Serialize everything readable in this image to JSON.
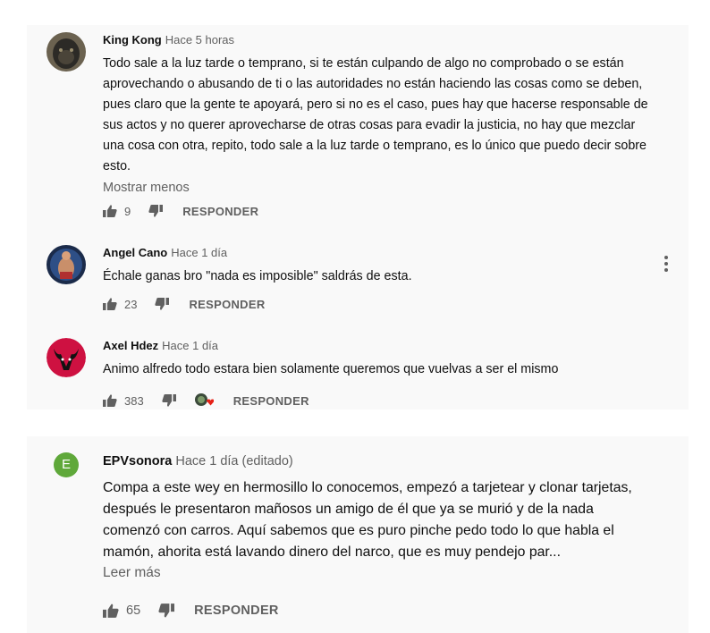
{
  "comments": [
    {
      "author": "King Kong",
      "time": "Hace 5 horas",
      "text": "Todo sale a la luz tarde o temprano, si te están culpando de algo no comprobado o se están aprovechando o abusando de ti o las autoridades no están haciendo las cosas como se deben, pues claro que la gente te apoyará, pero si no es el caso, pues hay que hacerse responsable de sus actos y no querer aprovecharse de otras cosas para evadir la justicia, no hay que mezclar una cosa con otra, repito, todo sale a la luz tarde o temprano, es lo único que puedo decir sobre esto.",
      "expand_label": "Mostrar menos",
      "likes": "9",
      "reply_label": "RESPONDER"
    },
    {
      "author": "Angel Cano",
      "time": "Hace 1 día",
      "text": "Échale ganas bro \"nada es imposible\" saldrás de esta.",
      "likes": "23",
      "reply_label": "RESPONDER"
    },
    {
      "author": "Axel Hdez",
      "time": "Hace 1 día",
      "text": "Animo alfredo todo estara bien solamente queremos que vuelvas a ser el mismo",
      "likes": "383",
      "reply_label": "RESPONDER"
    },
    {
      "author": "EPVsonora",
      "time": "Hace 1 día (editado)",
      "avatar_letter": "E",
      "text": "Compa a este wey en hermosillo lo conocemos, empezó a tarjetear y clonar tarjetas, después le presentaron mañosos un amigo de él que ya se murió y de la nada comenzó con carros. Aquí sabemos que es puro pinche pedo todo lo que habla el mamón, ahorita está lavando dinero del narco, que es muy pendejo par...",
      "expand_label": "Leer más",
      "likes": "65",
      "reply_label": "RESPONDER"
    }
  ],
  "colors": {
    "panel_bg": "#f9f9f9",
    "secondary_text": "#606060",
    "avatar_e": "#5fa83a",
    "avatar_bulls": "#ce1141"
  }
}
